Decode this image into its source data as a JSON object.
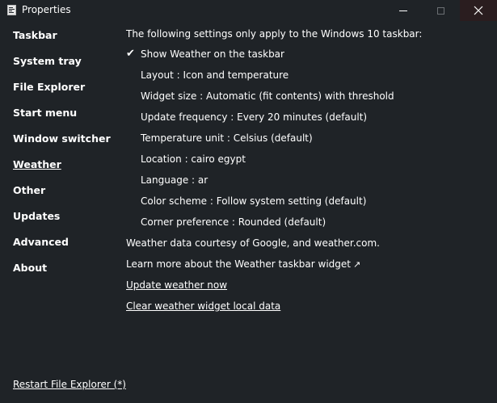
{
  "window": {
    "title": "Properties",
    "app_icon": "document-icon",
    "controls": {
      "minimize": "minimize-icon",
      "maximize": "maximize-icon",
      "close": "close-icon"
    }
  },
  "sidebar": {
    "items": [
      {
        "label": "Taskbar"
      },
      {
        "label": "System tray"
      },
      {
        "label": "File Explorer"
      },
      {
        "label": "Start menu"
      },
      {
        "label": "Window switcher"
      },
      {
        "label": "Weather",
        "active": true
      },
      {
        "label": "Other"
      },
      {
        "label": "Updates"
      },
      {
        "label": "Advanced"
      },
      {
        "label": "About"
      }
    ],
    "restart_link": "Restart File Explorer (*)"
  },
  "weather": {
    "header": "The following settings only apply to the Windows 10 taskbar:",
    "show_weather": {
      "label": "Show Weather on the taskbar",
      "checked": true
    },
    "settings": [
      {
        "label": "Layout : Icon and temperature"
      },
      {
        "label": "Widget size : Automatic (fit contents) with threshold"
      },
      {
        "label": "Update frequency : Every 20 minutes (default)"
      },
      {
        "label": "Temperature unit : Celsius (default)"
      },
      {
        "label": "Location : cairo egypt"
      },
      {
        "label": "Language : ar"
      },
      {
        "label": "Color scheme : Follow system setting (default)"
      },
      {
        "label": "Corner preference : Rounded (default)"
      }
    ],
    "attribution": "Weather data courtesy of Google, and weather.com.",
    "learn_more": "Learn more about the Weather taskbar widget",
    "learn_more_icon": "external-link-arrow-icon",
    "update_now": "Update weather now",
    "clear_data": "Clear weather widget local data"
  },
  "colors": {
    "background": "#1f2327",
    "text": "#ffffff",
    "close_hover": "#2a1d1f"
  }
}
